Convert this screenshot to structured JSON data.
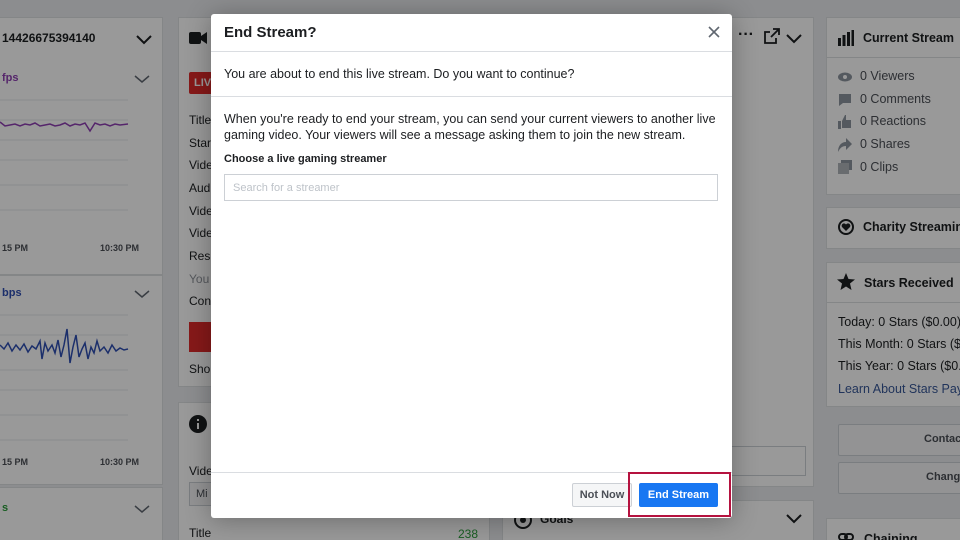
{
  "background": {
    "left_panel": {
      "stream_id": "14426675394140",
      "fps_label": "fps",
      "chart1_times": [
        "15 PM",
        "10:30 PM"
      ],
      "bps_label": "bps",
      "chart2_times": [
        "15 PM",
        "10:30 PM"
      ],
      "bottom_label": "s"
    },
    "middle_panel": {
      "live_badge": "LIV",
      "rows": [
        "Title",
        "Star",
        "Vide",
        "Aud",
        "Vide",
        "Vide",
        "Res",
        "You",
        "Con"
      ],
      "show_label": "Sho",
      "video_label": "Vide",
      "select_value": "Mi",
      "title_label": "Title",
      "title_count": "238"
    },
    "stats_panel": {
      "current_stream_title": "Current Stream",
      "viewers": "0 Viewers",
      "comments": "0 Comments",
      "reactions": "0 Reactions",
      "shares": "0 Shares",
      "clips": "0 Clips"
    },
    "charity_title": "Charity Streamin",
    "stars_panel": {
      "title": "Stars Received",
      "today": "Today: 0 Stars ($0.00)",
      "month": "This Month: 0 Stars ($",
      "year": "This Year: 0 Stars ($0.",
      "learn_link": "Learn About Stars Pay"
    },
    "contact_button": "Contac",
    "change_button": "Change",
    "goals_label": "Goals",
    "chaining_label": "Chaining"
  },
  "modal": {
    "title": "End Stream?",
    "message": "You are about to end this live stream. Do you want to continue?",
    "description": "When you're ready to end your stream, you can send your current viewers to another live gaming video. Your viewers will see a message asking them to join the new stream.",
    "search_label": "Choose a live gaming streamer",
    "search_placeholder": "Search for a streamer",
    "not_now_label": "Not Now",
    "end_stream_label": "End Stream"
  },
  "colors": {
    "primary_button": "#1877f2",
    "highlight": "#b5123f",
    "chart_purple": "#8e3fb3",
    "chart_blue": "#2f4fb3",
    "live_red": "#e02a2a",
    "title_count_green": "#2a9d3a"
  }
}
